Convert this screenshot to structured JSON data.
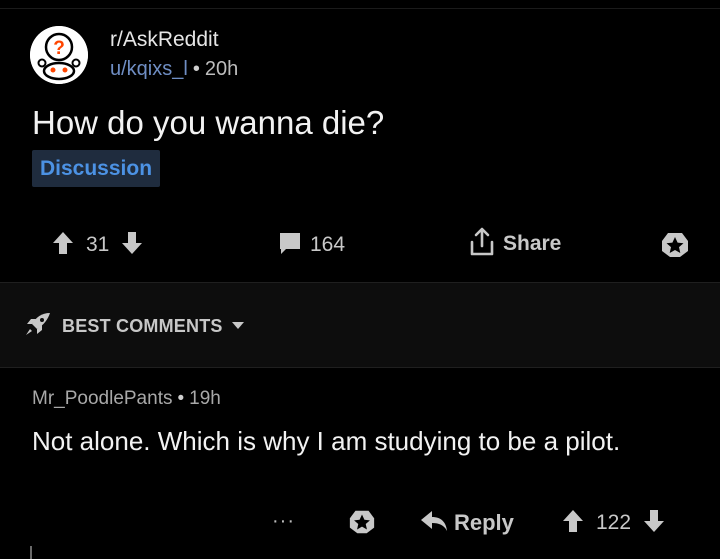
{
  "post": {
    "subreddit": "r/AskReddit",
    "author": "u/kqixs_l",
    "separator": "•",
    "age": "20h",
    "title": "How do you wanna die?",
    "flair": "Discussion",
    "score": "31",
    "comment_count": "164",
    "share_label": "Share"
  },
  "sort": {
    "label": "BEST COMMENTS"
  },
  "comment": {
    "author": "Mr_PoodlePants",
    "separator": "•",
    "age": "19h",
    "body": "Not alone.  Which is why I am studying to be a pilot.",
    "more_label": "···",
    "reply_label": "Reply",
    "score": "122"
  },
  "icons": {
    "avatar": "askreddit-snoo-icon",
    "upvote": "upvote-arrow-icon",
    "downvote": "downvote-arrow-icon",
    "comments": "comment-bubble-icon",
    "share": "share-icon",
    "award": "award-star-icon",
    "sort": "rocket-icon",
    "caret": "chevron-down-icon",
    "reply": "reply-arrow-icon"
  },
  "colors": {
    "background": "#000000",
    "author_link": "#6f8ec4",
    "flair_text": "#4c92e4",
    "flair_bg": "#1f2c3e"
  }
}
